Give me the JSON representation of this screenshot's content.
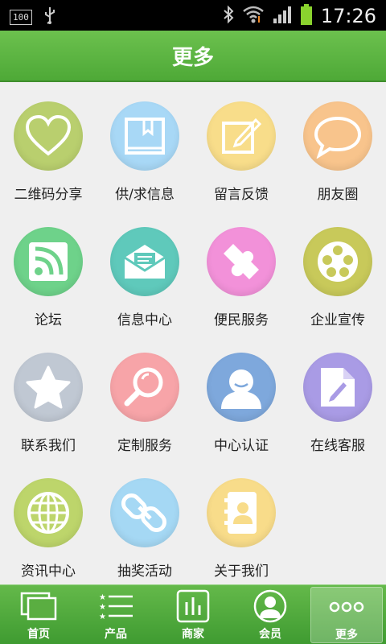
{
  "status_bar": {
    "battery_badge": "100",
    "time": "17:26"
  },
  "header": {
    "title": "更多"
  },
  "grid": {
    "items": [
      {
        "label": "二维码分享",
        "icon": "heart-icon",
        "color": "#b9cf6e"
      },
      {
        "label": "供/求信息",
        "icon": "book-icon",
        "color": "#a8d8f6"
      },
      {
        "label": "留言反馈",
        "icon": "edit-icon",
        "color": "#f8dd8a"
      },
      {
        "label": "朋友圈",
        "icon": "chat-bubble-icon",
        "color": "#f8c48c"
      },
      {
        "label": "论坛",
        "icon": "rss-icon",
        "color": "#6ed28a"
      },
      {
        "label": "信息中心",
        "icon": "mail-icon",
        "color": "#5fc9bb"
      },
      {
        "label": "便民服务",
        "icon": "puzzle-icon",
        "color": "#f291d9"
      },
      {
        "label": "企业宣传",
        "icon": "film-reel-icon",
        "color": "#c8c95a"
      },
      {
        "label": "联系我们",
        "icon": "star-icon",
        "color": "#c0c8d3"
      },
      {
        "label": "定制服务",
        "icon": "magnifier-icon",
        "color": "#f7a4a8"
      },
      {
        "label": "中心认证",
        "icon": "user-icon",
        "color": "#7ea8dc"
      },
      {
        "label": "在线客服",
        "icon": "document-edit-icon",
        "color": "#a99be5"
      },
      {
        "label": "资讯中心",
        "icon": "globe-icon",
        "color": "#bdd56b"
      },
      {
        "label": "抽奖活动",
        "icon": "link-icon",
        "color": "#a5d8f4"
      },
      {
        "label": "关于我们",
        "icon": "contacts-book-icon",
        "color": "#f8dc8a"
      }
    ]
  },
  "tabs": [
    {
      "label": "首页",
      "icon": "home-window-icon"
    },
    {
      "label": "产品",
      "icon": "list-star-icon"
    },
    {
      "label": "商家",
      "icon": "bar-chart-icon"
    },
    {
      "label": "会员",
      "icon": "person-icon"
    },
    {
      "label": "更多",
      "icon": "more-dots-icon",
      "active": true
    }
  ]
}
